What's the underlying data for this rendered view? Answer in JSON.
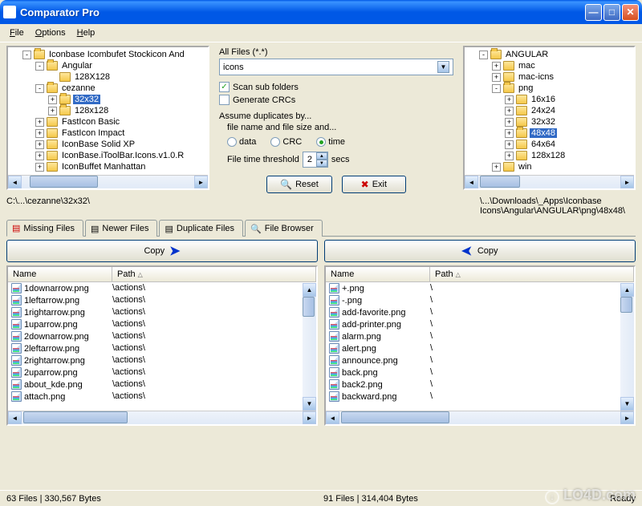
{
  "window": {
    "title": "Comparator Pro"
  },
  "menu": {
    "file": "File",
    "options": "Options",
    "help": "Help"
  },
  "tree_left": {
    "items": [
      {
        "indent": 1,
        "toggle": "-",
        "label": "Iconbase Icombufet Stockicon And",
        "open": true
      },
      {
        "indent": 2,
        "toggle": "-",
        "label": "Angular",
        "open": true
      },
      {
        "indent": 3,
        "toggle": "",
        "label": "128X128",
        "open": false
      },
      {
        "indent": 2,
        "toggle": "-",
        "label": "cezanne",
        "open": true
      },
      {
        "indent": 3,
        "toggle": "+",
        "label": "32x32",
        "open": true,
        "selected": true
      },
      {
        "indent": 3,
        "toggle": "+",
        "label": "128x128",
        "open": true
      },
      {
        "indent": 2,
        "toggle": "+",
        "label": "FastIcon Basic",
        "open": false
      },
      {
        "indent": 2,
        "toggle": "+",
        "label": "FastIcon Impact",
        "open": false
      },
      {
        "indent": 2,
        "toggle": "+",
        "label": "IconBase Solid XP",
        "open": false
      },
      {
        "indent": 2,
        "toggle": "+",
        "label": "IconBase.iToolBar.Icons.v1.0.R",
        "open": false
      },
      {
        "indent": 2,
        "toggle": "+",
        "label": "IconBuffet Manhattan",
        "open": false
      }
    ]
  },
  "tree_right": {
    "items": [
      {
        "indent": 1,
        "toggle": "-",
        "label": "ANGULAR",
        "open": true
      },
      {
        "indent": 2,
        "toggle": "+",
        "label": "mac",
        "open": false
      },
      {
        "indent": 2,
        "toggle": "+",
        "label": "mac-icns",
        "open": false
      },
      {
        "indent": 2,
        "toggle": "-",
        "label": "png",
        "open": true
      },
      {
        "indent": 3,
        "toggle": "+",
        "label": "16x16",
        "open": false
      },
      {
        "indent": 3,
        "toggle": "+",
        "label": "24x24",
        "open": false
      },
      {
        "indent": 3,
        "toggle": "+",
        "label": "32x32",
        "open": false
      },
      {
        "indent": 3,
        "toggle": "+",
        "label": "48x48",
        "open": true,
        "selected": true
      },
      {
        "indent": 3,
        "toggle": "+",
        "label": "64x64",
        "open": false
      },
      {
        "indent": 3,
        "toggle": "+",
        "label": "128x128",
        "open": false
      },
      {
        "indent": 2,
        "toggle": "+",
        "label": "win",
        "open": false
      }
    ]
  },
  "options": {
    "all_files_label": "All Files (*.*)",
    "filter_value": "icons",
    "scan_sub_label": "Scan sub folders",
    "scan_sub_checked": true,
    "gen_crc_label": "Generate CRCs",
    "gen_crc_checked": false,
    "assume_label": "Assume duplicates by...",
    "assume_sub": "file name and file size and...",
    "radio_data": "data",
    "radio_crc": "CRC",
    "radio_time": "time",
    "radio_selected": "time",
    "threshold_label": "File time threshold",
    "threshold_value": "2",
    "threshold_unit": "secs",
    "reset_label": "Reset",
    "exit_label": "Exit"
  },
  "paths": {
    "left": "C:\\...\\cezanne\\32x32\\",
    "right": "\\...\\Downloads\\_Apps\\Iconbase Icons\\Angular\\ANGULAR\\png\\48x48\\"
  },
  "tabs": {
    "missing": "Missing Files",
    "newer": "Newer Files",
    "duplicate": "Duplicate Files",
    "browser": "File Browser",
    "active": "missing"
  },
  "copy": {
    "label": "Copy"
  },
  "listHeaders": {
    "name": "Name",
    "path": "Path"
  },
  "list_left": {
    "rows": [
      {
        "name": "1downarrow.png",
        "path": "\\actions\\"
      },
      {
        "name": "1leftarrow.png",
        "path": "\\actions\\"
      },
      {
        "name": "1rightarrow.png",
        "path": "\\actions\\"
      },
      {
        "name": "1uparrow.png",
        "path": "\\actions\\"
      },
      {
        "name": "2downarrow.png",
        "path": "\\actions\\"
      },
      {
        "name": "2leftarrow.png",
        "path": "\\actions\\"
      },
      {
        "name": "2rightarrow.png",
        "path": "\\actions\\"
      },
      {
        "name": "2uparrow.png",
        "path": "\\actions\\"
      },
      {
        "name": "about_kde.png",
        "path": "\\actions\\"
      },
      {
        "name": "attach.png",
        "path": "\\actions\\"
      }
    ]
  },
  "list_right": {
    "rows": [
      {
        "name": "+.png",
        "path": "\\"
      },
      {
        "name": "-.png",
        "path": "\\"
      },
      {
        "name": "add-favorite.png",
        "path": "\\"
      },
      {
        "name": "add-printer.png",
        "path": "\\"
      },
      {
        "name": "alarm.png",
        "path": "\\"
      },
      {
        "name": "alert.png",
        "path": "\\"
      },
      {
        "name": "announce.png",
        "path": "\\"
      },
      {
        "name": "back.png",
        "path": "\\"
      },
      {
        "name": "back2.png",
        "path": "\\"
      },
      {
        "name": "backward.png",
        "path": "\\"
      }
    ]
  },
  "status": {
    "left": "63 Files  |  330,567 Bytes",
    "right": "91 Files  |  314,404 Bytes",
    "ready": "Ready"
  },
  "watermark": "LO4D.com"
}
